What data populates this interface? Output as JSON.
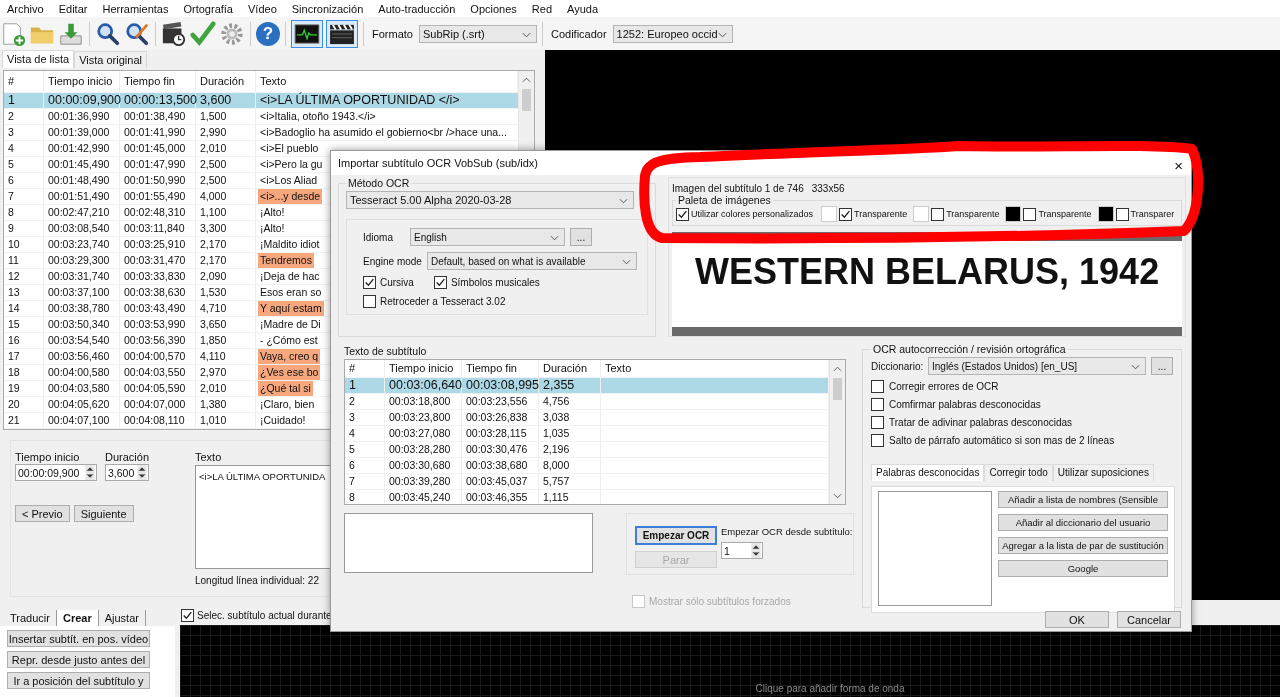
{
  "menu": [
    "Archivo",
    "Editar",
    "Herramientas",
    "Ortografía",
    "Vídeo",
    "Sincronización",
    "Auto-traducción",
    "Opciones",
    "Red",
    "Ayuda"
  ],
  "toolbar": {
    "help_label": "?",
    "toggles": [
      {
        "kind": "waveform",
        "pressed": true
      },
      {
        "kind": "video",
        "pressed": true
      }
    ],
    "format_label": "Formato",
    "format": "SubRip (.srt)",
    "encoding_label": "Codificador",
    "encoding": "1252: Europeo occid"
  },
  "view_tabs": [
    {
      "label": "Vista de lista",
      "selected": true
    },
    {
      "label": "Vista original",
      "selected": false
    }
  ],
  "list": {
    "columns": [
      "#",
      "Tiempo inicio",
      "Tiempo fin",
      "Duración",
      "Texto"
    ],
    "rows": [
      {
        "cells": [
          "1",
          "00:00:09,900",
          "00:00:13,500",
          "3,600",
          "<i>LA ÚLTIMA OPORTUNIDAD </i>"
        ],
        "selected": true,
        "warning": false
      },
      {
        "cells": [
          "2",
          "00:01:36,990",
          "00:01:38,490",
          "1,500",
          "<i>Italia, otoño 1943.</i>"
        ],
        "selected": false,
        "warning": false
      },
      {
        "cells": [
          "3",
          "00:01:39,000",
          "00:01:41,990",
          "2,990",
          "<i>Badoglio ha asumido el gobierno<br />hace una..."
        ],
        "selected": false,
        "warning": false
      },
      {
        "cells": [
          "4",
          "00:01:42,990",
          "00:01:45,000",
          "2,010",
          "<i>El pueblo"
        ],
        "selected": false,
        "warning": false
      },
      {
        "cells": [
          "5",
          "00:01:45,490",
          "00:01:47,990",
          "2,500",
          "<i>Pero la gu"
        ],
        "selected": false,
        "warning": false
      },
      {
        "cells": [
          "6",
          "00:01:48,490",
          "00:01:50,990",
          "2,500",
          "<i>Los Aliad"
        ],
        "selected": false,
        "warning": false
      },
      {
        "cells": [
          "7",
          "00:01:51,490",
          "00:01:55,490",
          "4,000",
          "<i>...y desde"
        ],
        "selected": false,
        "warning": true
      },
      {
        "cells": [
          "8",
          "00:02:47,210",
          "00:02:48,310",
          "1,100",
          "¡Alto!"
        ],
        "selected": false,
        "warning": false
      },
      {
        "cells": [
          "9",
          "00:03:08,540",
          "00:03:11,840",
          "3,300",
          "¡Alto!"
        ],
        "selected": false,
        "warning": false
      },
      {
        "cells": [
          "10",
          "00:03:23,740",
          "00:03:25,910",
          "2,170",
          "¡Maldito idiot"
        ],
        "selected": false,
        "warning": false
      },
      {
        "cells": [
          "11",
          "00:03:29,300",
          "00:03:31,470",
          "2,170",
          "Tendremos"
        ],
        "selected": false,
        "warning": true
      },
      {
        "cells": [
          "12",
          "00:03:31,740",
          "00:03:33,830",
          "2,090",
          "¡Deja de hac"
        ],
        "selected": false,
        "warning": false
      },
      {
        "cells": [
          "13",
          "00:03:37,100",
          "00:03:38,630",
          "1,530",
          "Esos eran so"
        ],
        "selected": false,
        "warning": false
      },
      {
        "cells": [
          "14",
          "00:03:38,780",
          "00:03:43,490",
          "4,710",
          "Y aquí estam"
        ],
        "selected": false,
        "warning": true
      },
      {
        "cells": [
          "15",
          "00:03:50,340",
          "00:03:53,990",
          "3,650",
          "¡Madre de Di"
        ],
        "selected": false,
        "warning": false
      },
      {
        "cells": [
          "16",
          "00:03:54,540",
          "00:03:56,390",
          "1,850",
          "- ¿Cómo est"
        ],
        "selected": false,
        "warning": false
      },
      {
        "cells": [
          "17",
          "00:03:56,460",
          "00:04:00,570",
          "4,110",
          "Vaya, creo q"
        ],
        "selected": false,
        "warning": true
      },
      {
        "cells": [
          "18",
          "00:04:00,580",
          "00:04:03,550",
          "2,970",
          "¿Ves ese bo"
        ],
        "selected": false,
        "warning": true
      },
      {
        "cells": [
          "19",
          "00:04:03,580",
          "00:04:05,590",
          "2,010",
          "¿Qué tal si"
        ],
        "selected": false,
        "warning": true
      },
      {
        "cells": [
          "20",
          "00:04:05,620",
          "00:04:07,000",
          "1,380",
          "¡Claro, bien"
        ],
        "selected": false,
        "warning": false
      },
      {
        "cells": [
          "21",
          "00:04:07,100",
          "00:04:08,110",
          "1,010",
          "¡Cuidado!"
        ],
        "selected": false,
        "warning": false
      }
    ]
  },
  "editor": {
    "start_label": "Tiempo inicio",
    "start": "00:00:09,900",
    "duration_label": "Duración",
    "duration": "3,600",
    "text_label": "Texto",
    "text": "<i>LA ÚLTIMA OPORTUNIDA",
    "prev": "< Previo",
    "next": "Siguiente",
    "line_length": "Longitud línea individual: 22"
  },
  "bottom_tabs": [
    {
      "label": "Traducir",
      "selected": false
    },
    {
      "label": "Crear",
      "selected": true
    },
    {
      "label": "Ajustar",
      "selected": false
    }
  ],
  "bottom_buttons": [
    "Insertar subtít. en pos. vídeo",
    "Repr. desde justo antes del",
    "Ir a posición del subtítulo y"
  ],
  "follow": {
    "label": "Selec. subtítulo actual durante",
    "checked": true
  },
  "waveform_hint": "Clique para añadir forma de onda",
  "dialog": {
    "title": "Importar subtítulo OCR VobSub (sub/idx)",
    "close": "×",
    "ocr": {
      "legend": "Método OCR",
      "engine": "Tesseract 5.00 Alpha 2020-03-28",
      "language_label": "Idioma",
      "language": "English",
      "more": "...",
      "mode_label": "Engine mode",
      "mode": "Default, based on what is available",
      "options": [
        {
          "label": "Cursiva",
          "checked": true
        },
        {
          "label": "Símbolos musicales",
          "checked": true
        },
        {
          "label": "Retroceder a Tesseract 3.02",
          "checked": false
        }
      ]
    },
    "image": {
      "caption": "Imagen del subtítulo 1 de 746",
      "size": "333x56",
      "palette_legend": "Paleta de imágenes",
      "custom": {
        "label": "Utilizar colores personalizados",
        "checked": true
      },
      "palette": [
        {
          "color": "#ffffff",
          "label": "Transparente",
          "checked": true
        },
        {
          "color": "#ffffff",
          "label": "Transparente",
          "checked": false
        },
        {
          "color": "#000000",
          "label": "Transparente",
          "checked": false
        },
        {
          "color": "#000000",
          "label": "Transparer",
          "checked": false
        }
      ],
      "subtitle_text": "WESTERN BELARUS, 1942"
    },
    "subtitles": {
      "label": "Texto de subtítulo",
      "columns": [
        "#",
        "Tiempo inicio",
        "Tiempo fin",
        "Duración",
        "Texto"
      ],
      "rows": [
        {
          "cells": [
            "1",
            "00:03:06,640",
            "00:03:08,995",
            "2,355"
          ],
          "selected": true
        },
        {
          "cells": [
            "2",
            "00:03:18,800",
            "00:03:23,556",
            "4,756"
          ],
          "selected": false
        },
        {
          "cells": [
            "3",
            "00:03:23,800",
            "00:03:26,838",
            "3,038"
          ],
          "selected": false
        },
        {
          "cells": [
            "4",
            "00:03:27,080",
            "00:03:28,115",
            "1,035"
          ],
          "selected": false
        },
        {
          "cells": [
            "5",
            "00:03:28,280",
            "00:03:30,476",
            "2,196"
          ],
          "selected": false
        },
        {
          "cells": [
            "6",
            "00:03:30,680",
            "00:03:38,680",
            "8,000"
          ],
          "selected": false
        },
        {
          "cells": [
            "7",
            "00:03:39,280",
            "00:03:45,037",
            "5,757"
          ],
          "selected": false
        },
        {
          "cells": [
            "8",
            "00:03:45,240",
            "00:03:46,355",
            "1,115"
          ],
          "selected": false
        }
      ]
    },
    "start_ocr": "Empezar OCR",
    "stop": {
      "label": "Parar",
      "disabled": true
    },
    "start_from_label": "Empezar OCR desde subtítulo:",
    "start_from": "1",
    "forced_only": {
      "label": "Mostrar sólo subtítulos forzados",
      "checked": false,
      "disabled": true
    },
    "autocorrect": {
      "legend": "OCR autocorrección / revisión ortográfica",
      "dictionary_label": "Diccionario:",
      "dictionary": "Inglés (Estados Unidos) [en_US]",
      "more": "...",
      "options": [
        {
          "label": "Corregir errores de OCR",
          "checked": false
        },
        {
          "label": "Comfirmar palabras desconocidas",
          "checked": false
        },
        {
          "label": "Tratar de adivinar palabras desconocidas",
          "checked": false
        },
        {
          "label": "Salto de párrafo automático si son mas de 2 líneas",
          "checked": false
        }
      ],
      "tabs": [
        {
          "label": "Palabras desconocidas",
          "selected": true
        },
        {
          "label": "Corregir todo",
          "selected": false
        },
        {
          "label": "Utilizar suposiciones",
          "selected": false
        }
      ],
      "buttons": [
        "Añadir a lista de nombres (Sensible",
        "Añadir al diccionario del usuario",
        "Agregar a la lista de par de sustitución",
        "Google"
      ]
    },
    "ok": "OK",
    "cancel": "Cancelar"
  }
}
